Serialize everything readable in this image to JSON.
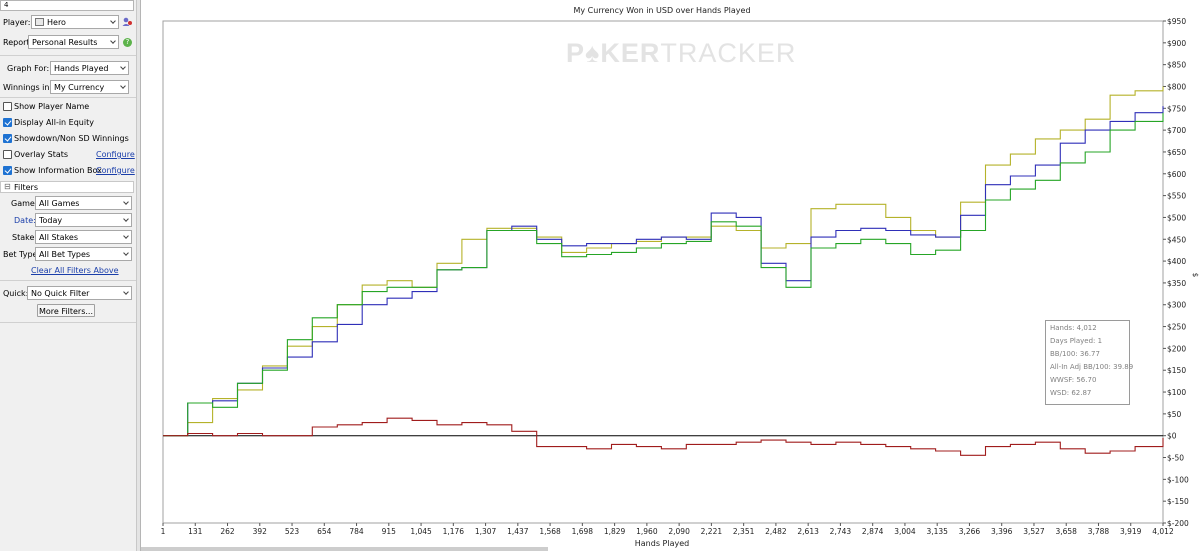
{
  "left_panel": {
    "search_value": "4",
    "player_label": "Player:",
    "player_value": "Hero",
    "report_label": "Report:",
    "report_value": "Personal Results",
    "graph_for_label": "Graph For:",
    "graph_for_value": "Hands Played",
    "winnings_in_label": "Winnings in:",
    "winnings_in_value": "My Currency",
    "options": [
      {
        "label": "Show Player Name",
        "checked": false
      },
      {
        "label": "Display All-in Equity",
        "checked": true
      },
      {
        "label": "Showdown/Non SD Winnings",
        "checked": true
      },
      {
        "label": "Overlay Stats",
        "checked": false
      },
      {
        "label": "Show Information Box",
        "checked": true
      }
    ],
    "configure_label": "Configure",
    "filters_header": "Filters",
    "game_label": "Game:",
    "game_value": "All Games",
    "date_label": "Date:",
    "date_value": "Today",
    "stake_label": "Stake:",
    "stake_value": "All Stakes",
    "bet_type_label": "Bet Type:",
    "bet_type_value": "All Bet Types",
    "clear_filters_label": "Clear All Filters Above",
    "quick_label": "Quick:",
    "quick_value": "No Quick Filter",
    "more_filters_label": "More Filters..."
  },
  "chart": {
    "watermark_bold": "P♠KER",
    "watermark_light": "TRACKER"
  },
  "info_box": {
    "hands": "Hands: 4,012",
    "days_played": "Days Played: 1",
    "bb100": "BB/100: 36.77",
    "allin_adj": "All-In Adj BB/100: 39.89",
    "wwsf": "WWSF: 56.70",
    "wsd": "WSD: 62.87"
  },
  "colors": {
    "allin_equity": "#b5b22a",
    "total": "#2f2fb8",
    "showdown": "#26a526",
    "non_showdown": "#a01c1c",
    "link": "#1a3eaa"
  },
  "chart_data": {
    "type": "line",
    "title": "My Currency Won in USD over Hands Played",
    "xlabel": "Hands Played",
    "ylabel": "$",
    "x_ticks": [
      "1",
      "131",
      "262",
      "392",
      "523",
      "654",
      "784",
      "915",
      "1,045",
      "1,176",
      "1,307",
      "1,437",
      "1,568",
      "1,698",
      "1,829",
      "1,960",
      "2,090",
      "2,221",
      "2,351",
      "2,482",
      "2,613",
      "2,743",
      "2,874",
      "3,004",
      "3,135",
      "3,266",
      "3,396",
      "3,527",
      "3,658",
      "3,788",
      "3,919",
      "4,012"
    ],
    "y_ticks": [
      "$950",
      "$900",
      "$850",
      "$800",
      "$750",
      "$700",
      "$650",
      "$600",
      "$550",
      "$500",
      "$450",
      "$400",
      "$350",
      "$300",
      "$250",
      "$200",
      "$150",
      "$100",
      "$50",
      "$0",
      "$-50",
      "$-100",
      "$-150",
      "$-200"
    ],
    "xlim": [
      1,
      4012
    ],
    "ylim": [
      -200,
      950
    ],
    "grid": false,
    "series": [
      {
        "key": "allin_equity",
        "color": "#b5b22a",
        "x": [
          1,
          100,
          200,
          300,
          400,
          500,
          600,
          700,
          800,
          900,
          1000,
          1100,
          1200,
          1300,
          1400,
          1500,
          1600,
          1700,
          1800,
          1900,
          2000,
          2100,
          2200,
          2300,
          2400,
          2500,
          2600,
          2700,
          2800,
          2900,
          3000,
          3100,
          3200,
          3300,
          3400,
          3500,
          3600,
          3700,
          3800,
          3900,
          4012
        ],
        "y": [
          0,
          30,
          85,
          105,
          160,
          205,
          250,
          300,
          345,
          355,
          340,
          395,
          450,
          475,
          475,
          455,
          420,
          430,
          440,
          445,
          455,
          455,
          480,
          470,
          430,
          440,
          520,
          530,
          530,
          500,
          470,
          455,
          535,
          620,
          645,
          680,
          700,
          725,
          780,
          790,
          800
        ]
      },
      {
        "key": "total",
        "color": "#2f2fb8",
        "x": [
          1,
          100,
          200,
          300,
          400,
          500,
          600,
          700,
          800,
          900,
          1000,
          1100,
          1200,
          1300,
          1400,
          1500,
          1600,
          1700,
          1800,
          1900,
          2000,
          2100,
          2200,
          2300,
          2400,
          2500,
          2600,
          2700,
          2800,
          2900,
          3000,
          3100,
          3200,
          3300,
          3400,
          3500,
          3600,
          3700,
          3800,
          3900,
          4012
        ],
        "y": [
          0,
          75,
          80,
          120,
          155,
          180,
          215,
          255,
          300,
          315,
          330,
          380,
          385,
          470,
          480,
          450,
          435,
          440,
          440,
          450,
          455,
          450,
          510,
          500,
          395,
          355,
          455,
          470,
          475,
          470,
          460,
          455,
          505,
          575,
          595,
          620,
          670,
          700,
          720,
          740,
          755
        ]
      },
      {
        "key": "showdown",
        "color": "#26a526",
        "x": [
          1,
          100,
          200,
          300,
          400,
          500,
          600,
          700,
          800,
          900,
          1000,
          1100,
          1200,
          1300,
          1400,
          1500,
          1600,
          1700,
          1800,
          1900,
          2000,
          2100,
          2200,
          2300,
          2400,
          2500,
          2600,
          2700,
          2800,
          2900,
          3000,
          3100,
          3200,
          3300,
          3400,
          3500,
          3600,
          3700,
          3800,
          3900,
          4012
        ],
        "y": [
          0,
          75,
          65,
          120,
          150,
          220,
          270,
          300,
          330,
          340,
          340,
          380,
          385,
          470,
          470,
          440,
          410,
          415,
          420,
          430,
          440,
          445,
          490,
          480,
          385,
          340,
          430,
          440,
          450,
          440,
          415,
          425,
          470,
          540,
          565,
          585,
          625,
          650,
          700,
          720,
          740
        ]
      },
      {
        "key": "non_showdown",
        "color": "#a01c1c",
        "x": [
          1,
          100,
          200,
          300,
          400,
          500,
          600,
          700,
          800,
          900,
          1000,
          1100,
          1200,
          1300,
          1400,
          1500,
          1600,
          1700,
          1800,
          1900,
          2000,
          2100,
          2200,
          2300,
          2400,
          2500,
          2600,
          2700,
          2800,
          2900,
          3000,
          3100,
          3200,
          3300,
          3400,
          3500,
          3600,
          3700,
          3800,
          3900,
          4012
        ],
        "y": [
          0,
          5,
          0,
          5,
          0,
          0,
          20,
          25,
          30,
          40,
          35,
          25,
          30,
          25,
          10,
          -25,
          -25,
          -30,
          -20,
          -25,
          -30,
          -20,
          -20,
          -15,
          -10,
          -15,
          -20,
          -15,
          -20,
          -25,
          -30,
          -35,
          -45,
          -25,
          -20,
          -15,
          -30,
          -40,
          -35,
          -25,
          -5
        ]
      }
    ]
  }
}
